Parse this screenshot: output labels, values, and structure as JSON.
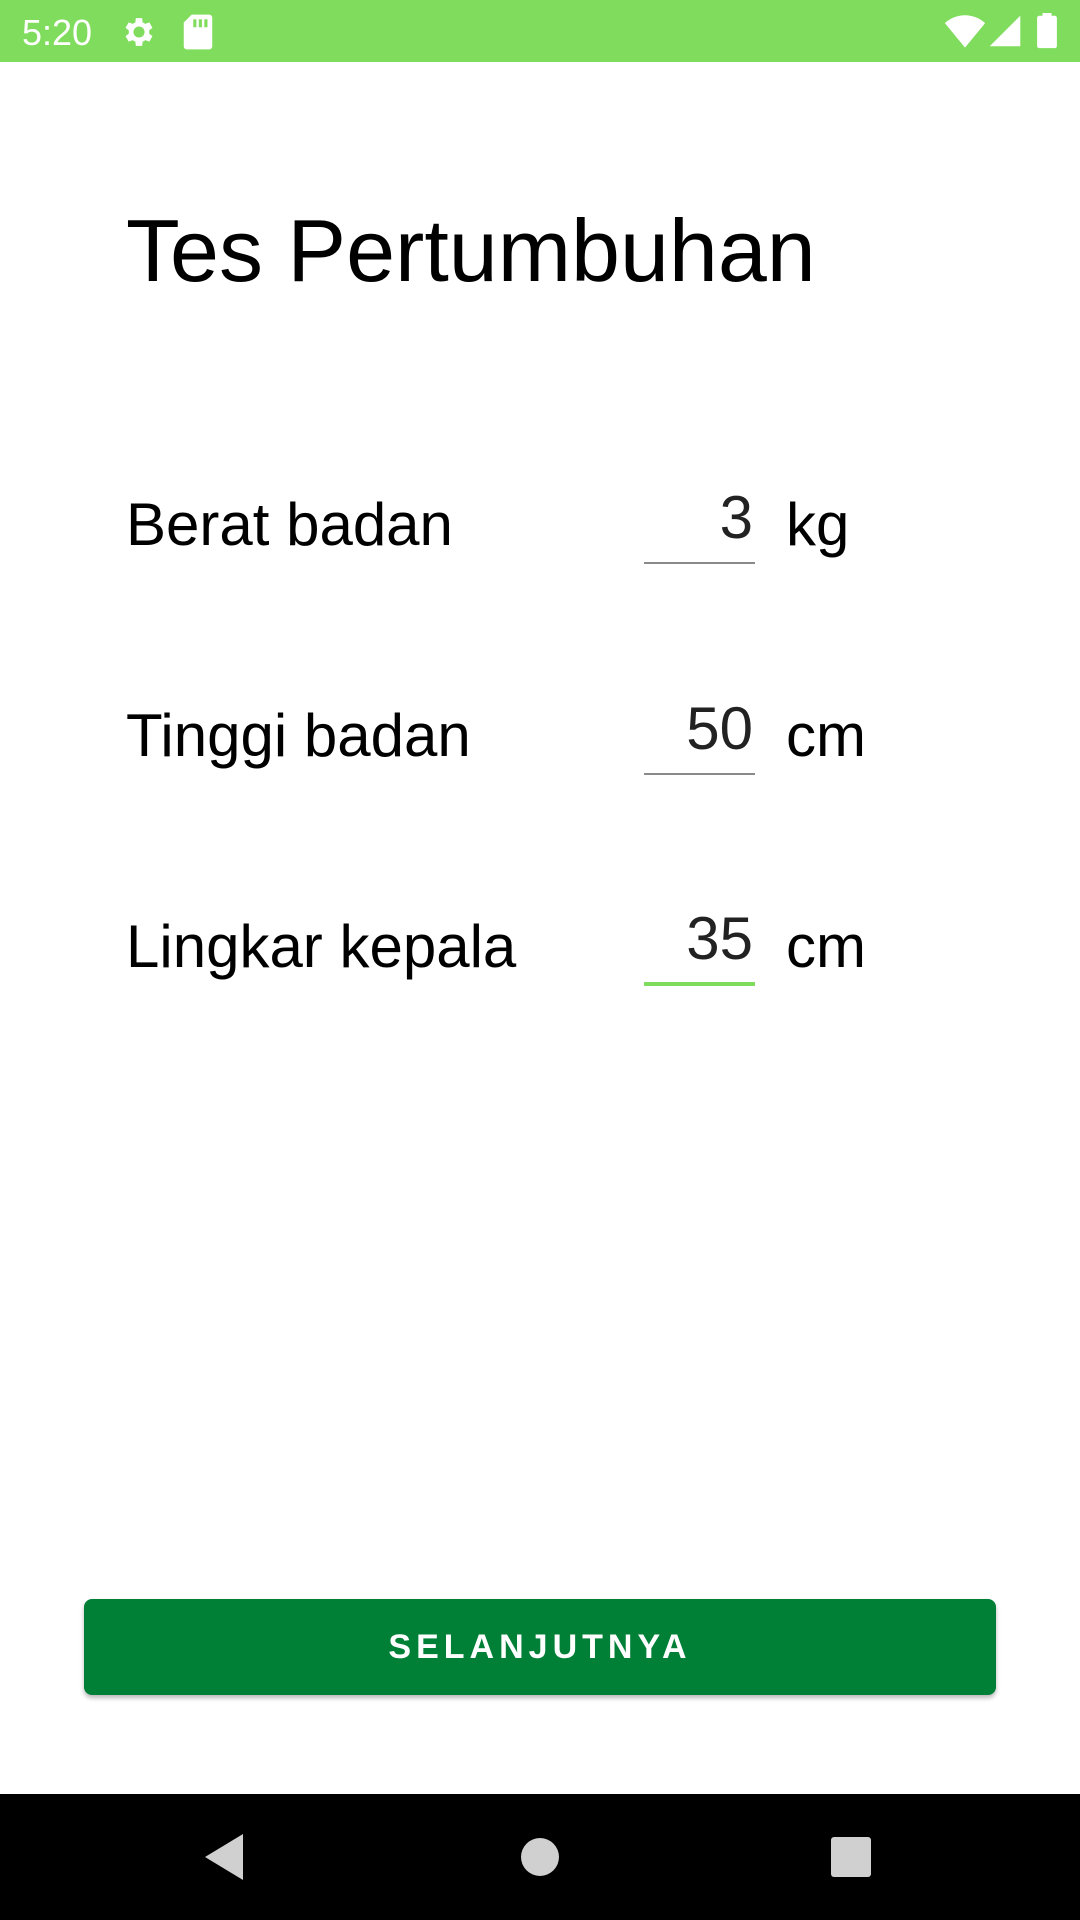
{
  "status_bar": {
    "time": "5:20",
    "background_color": "#80dc5c",
    "icons_left": [
      "gear-icon",
      "sd-card-icon"
    ],
    "icons_right": [
      "wifi-icon",
      "cell-signal-icon",
      "battery-icon"
    ]
  },
  "page": {
    "title": "Tes Pertumbuhan"
  },
  "form": {
    "rows": [
      {
        "label": "Berat badan",
        "value": "3",
        "unit": "kg",
        "focused": false
      },
      {
        "label": "Tinggi badan",
        "value": "50",
        "unit": "cm",
        "focused": false
      },
      {
        "label": "Lingkar kepala",
        "value": "35",
        "unit": "cm",
        "focused": true
      }
    ],
    "focus_color": "#80dc5c"
  },
  "actions": {
    "next_label": "SELANJUTNYA",
    "next_color": "#008037"
  },
  "nav_bar": {
    "buttons": [
      "back-icon",
      "home-icon",
      "recents-icon"
    ]
  }
}
